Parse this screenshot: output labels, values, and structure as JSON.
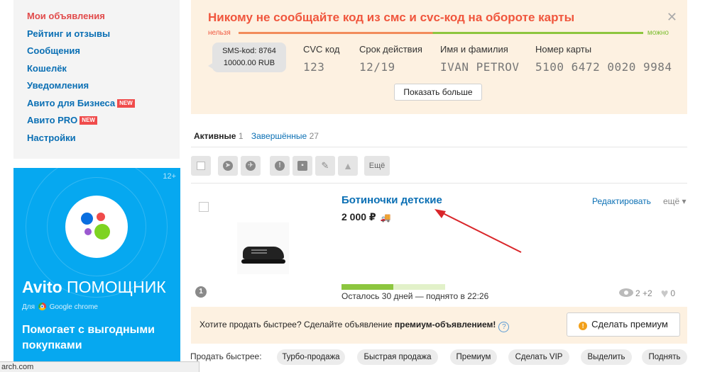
{
  "sidebar": {
    "items": [
      {
        "label": "Мои объявления",
        "active": true
      },
      {
        "label": "Рейтинг и отзывы"
      },
      {
        "label": "Сообщения"
      },
      {
        "label": "Кошелёк"
      },
      {
        "label": "Уведомления"
      },
      {
        "label": "Авито для Бизнеса",
        "badge": "NEW"
      },
      {
        "label": "Авито PRO",
        "badge": "NEW"
      },
      {
        "label": "Настройки"
      }
    ]
  },
  "ad": {
    "age": "12+",
    "brand_bold": "Avito",
    "brand_rest": "ПОМОЩНИК",
    "for_prefix": "Для",
    "for_browser": "Google chrome",
    "headline": "Помогает с выгодными покупками",
    "dot_colors": [
      "#0a6fe0",
      "#f04b4b",
      "#9b59d0",
      "#7ed321"
    ]
  },
  "warning": {
    "title": "Никому не сообщайте код из смс и cvc-код на обороте карты",
    "label_no": "нельзя",
    "label_ok": "можно",
    "sms_line1": "SMS-kod: 8764",
    "sms_line2": "10000.00 RUB",
    "cvc_label": "CVC код",
    "cvc_value": "123",
    "exp_label": "Срок действия",
    "exp_value": "12/19",
    "name_label": "Имя и фамилия",
    "name_value": "IVAN PETROV",
    "card_label": "Номер карты",
    "card_value": "5100 6472 0020 9984",
    "more_button": "Показать больше",
    "colors": {
      "danger": "#f0563d",
      "ok": "#7bbd2e"
    }
  },
  "tabs": [
    {
      "label": "Активные",
      "count": "1"
    },
    {
      "label": "Завершённые",
      "count": "27"
    }
  ],
  "toolbar": {
    "more_label": "Ещё",
    "icons": [
      "select-all-checkbox",
      "compass-icon",
      "plane-icon",
      "info-icon",
      "archive-icon",
      "eraser-icon",
      "up-arrow-icon"
    ]
  },
  "listing": {
    "title": "Ботиночки детские",
    "price": "2 000 ₽",
    "edit_label": "Редактировать",
    "edit_more": "ещё ▾",
    "progress": 0.5,
    "remaining": "Осталось 30 дней — поднято в 22:26",
    "info_badge": "1",
    "views": "2 +2",
    "likes": "0"
  },
  "promo": {
    "text_prefix": "Хотите продать быстрее? Сделайте объявление ",
    "text_bold": "премиум-объявлением!",
    "help": "?",
    "button": "Сделать премиум"
  },
  "quick_sell": {
    "label": "Продать быстрее:",
    "chips": [
      "Турбо-продажа",
      "Быстрая продажа",
      "Премиум",
      "Сделать VIP",
      "Выделить",
      "Поднять"
    ]
  },
  "status_bar": "arch.com"
}
